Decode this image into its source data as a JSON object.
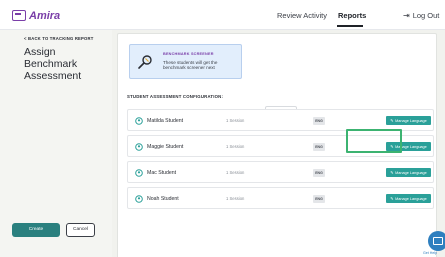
{
  "brand": {
    "logo_text": "Amira",
    "color": "#7a3ea8"
  },
  "nav": {
    "review_label": "Review Activity",
    "reports_label": "Reports",
    "logout_label": "Log Out",
    "logout_icon": "logout-arrow-icon"
  },
  "sidebar": {
    "back_label": "< BACK TO TRACKING REPORT",
    "title": "Assign Benchmark Assessment"
  },
  "banner": {
    "heading": "BENCHMARK SCREENER",
    "text": "These students will get the benchmark screener next",
    "icon": "magnifier-icon",
    "background": "#e2eefc"
  },
  "config": {
    "label": "STUDENT ASSESSMENT CONFIGURATION:",
    "english_only_label": "English Only"
  },
  "students": [
    {
      "name": "Matilda Student",
      "sessions": "1 Session",
      "language": "ENG",
      "action": "Manage Language"
    },
    {
      "name": "Maggie Student",
      "sessions": "1 Session",
      "language": "ENG",
      "action": "Manage Language"
    },
    {
      "name": "Mac Student",
      "sessions": "1 Session",
      "language": "ENG",
      "action": "Manage Language"
    },
    {
      "name": "Noah Student",
      "sessions": "1 Session",
      "language": "ENG",
      "action": "Manage Language"
    }
  ],
  "actions": {
    "create_label": "Create",
    "cancel_label": "Cancel"
  },
  "help": {
    "label": "Get Help"
  },
  "colors": {
    "accent": "#2aa099",
    "create": "#2a807f",
    "highlight": "#3cb371"
  }
}
